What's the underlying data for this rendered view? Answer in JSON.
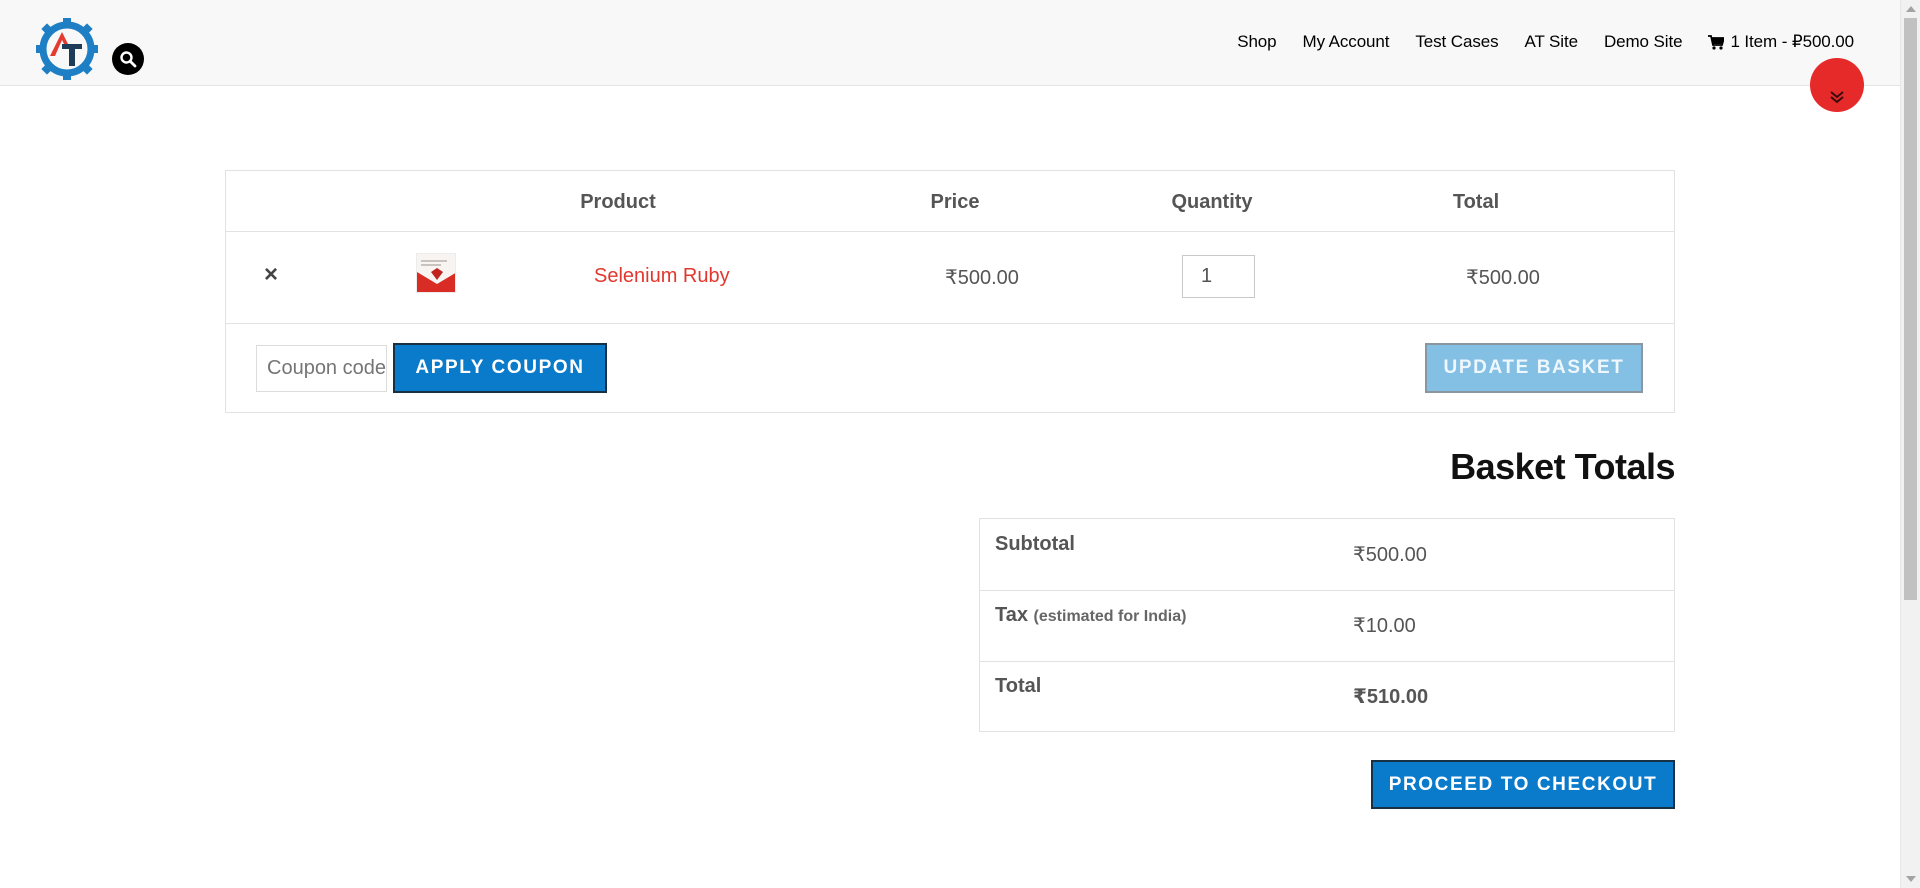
{
  "header": {
    "nav": {
      "shop": "Shop",
      "my_account": "My Account",
      "test_cases": "Test Cases",
      "at_site": "AT Site",
      "demo_site": "Demo Site",
      "cart": "1 Item - ₽500.00"
    },
    "icons": {
      "logo": "automation-testing-logo",
      "search": "search-icon",
      "cart": "cart-icon",
      "scroll": "chevron-double-down-icon"
    }
  },
  "cart_table": {
    "headers": {
      "product": "Product",
      "price": "Price",
      "quantity": "Quantity",
      "total": "Total"
    },
    "items": [
      {
        "remove": "×",
        "name": "Selenium Ruby",
        "price": "₹500.00",
        "quantity": "1",
        "total": "₹500.00"
      }
    ],
    "coupon": {
      "placeholder": "Coupon code",
      "apply_label": "Apply Coupon"
    },
    "update_label": "Update Basket"
  },
  "totals": {
    "title": "Basket Totals",
    "subtotal_label": "Subtotal",
    "subtotal_value": "₹500.00",
    "tax_label": "Tax",
    "tax_note": "(estimated for India)",
    "tax_value": "₹10.00",
    "total_label": "Total",
    "total_value": "₹510.00",
    "checkout_label": "Proceed to Checkout"
  },
  "colors": {
    "accent_blue": "#0a7acb",
    "link_red": "#e0382e",
    "scroll_button_red": "#e62a2a"
  }
}
